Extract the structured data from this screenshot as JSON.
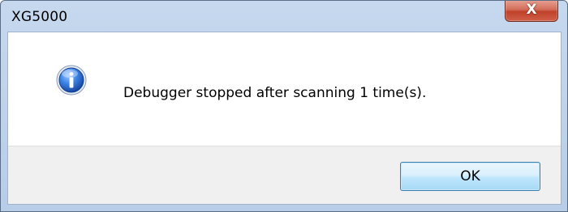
{
  "window": {
    "title": "XG5000",
    "close_label": "X"
  },
  "dialog": {
    "icon": "info-icon",
    "message": "Debugger stopped after scanning 1 time(s).",
    "ok_label": "OK"
  },
  "colors": {
    "frame": "#c6d8ee",
    "close_button": "#c0412a",
    "ok_button": "#bee6fd",
    "button_area": "#f0f0f0",
    "info_icon": "#1f5fbf"
  }
}
